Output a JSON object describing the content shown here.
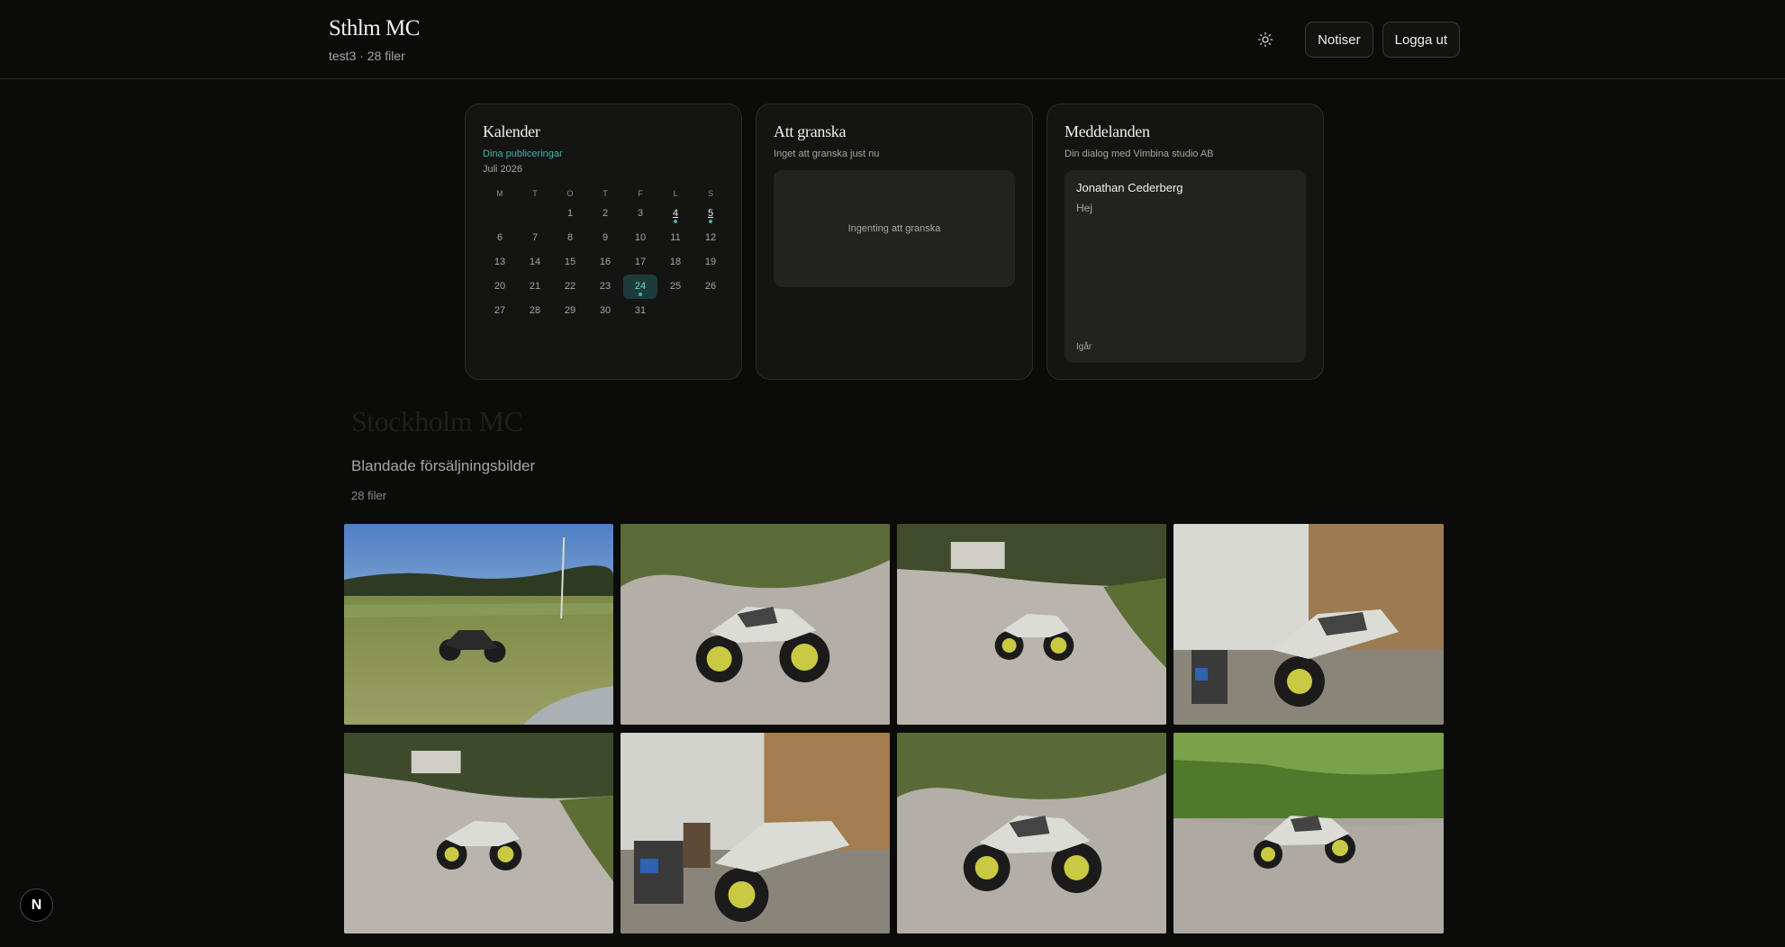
{
  "header": {
    "brand_title": "Sthlm MC",
    "brand_subtitle": "test3 · 28 filer",
    "theme_icon": "sun-icon",
    "notifications_label": "Notiser",
    "logout_label": "Logga ut"
  },
  "calendar": {
    "title": "Kalender",
    "subtitle": "Dina publiceringar",
    "month": "Juli 2026",
    "weekdays": [
      "M",
      "T",
      "O",
      "T",
      "F",
      "L",
      "S"
    ],
    "leading_blanks": 2,
    "days": [
      "1",
      "2",
      "3",
      "4",
      "5",
      "6",
      "7",
      "8",
      "9",
      "10",
      "11",
      "12",
      "13",
      "14",
      "15",
      "16",
      "17",
      "18",
      "19",
      "20",
      "21",
      "22",
      "23",
      "24",
      "25",
      "26",
      "27",
      "28",
      "29",
      "30",
      "31"
    ],
    "publication_days": [
      "4",
      "5"
    ],
    "today": "24"
  },
  "review": {
    "title": "Att granska",
    "subtitle": "Inget att granska just nu",
    "empty_text": "Ingenting att granska"
  },
  "messages": {
    "title": "Meddelanden",
    "subtitle": "Din dialog med Vimbina studio AB",
    "sender": "Jonathan Cederberg",
    "text": "Hej",
    "time": "Igår"
  },
  "gallery": {
    "title": "Stockholm MC",
    "subtitle": "Blandade försäljningsbilder",
    "count": "28 filer",
    "photos": [
      "field",
      "gravel",
      "gravel-wide",
      "garage",
      "gravel-house",
      "garage-side",
      "gravel-close",
      "forest"
    ]
  },
  "dev_badge": "N",
  "colors": {
    "background": "#0b0b0a",
    "card": "#141413",
    "accent": "#3fb6ad"
  }
}
